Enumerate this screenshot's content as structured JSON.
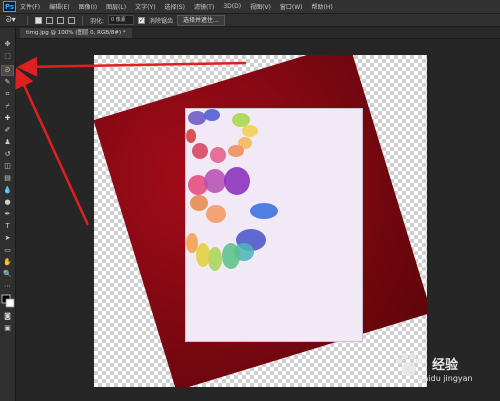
{
  "app": {
    "logo": "Ps"
  },
  "menu": [
    "文件(F)",
    "编辑(E)",
    "图像(I)",
    "图层(L)",
    "文字(Y)",
    "选择(S)",
    "滤镜(T)",
    "3D(D)",
    "视图(V)",
    "窗口(W)",
    "帮助(H)"
  ],
  "options": {
    "feather_label": "羽化:",
    "feather_value": "0 像素",
    "antialias_label": "消除锯齿",
    "select_mask_button": "选择并遮住..."
  },
  "tab": {
    "title": "timg.jpg @ 100% (图层 0, RGB/8#) *"
  },
  "tools": [
    {
      "name": "move-tool",
      "glyph": "✥"
    },
    {
      "name": "marquee-tool",
      "glyph": "⬚"
    },
    {
      "name": "lasso-tool",
      "glyph": "ᘐ"
    },
    {
      "name": "quick-select-tool",
      "glyph": "✎"
    },
    {
      "name": "crop-tool",
      "glyph": "⌗"
    },
    {
      "name": "eyedropper-tool",
      "glyph": "⌿"
    },
    {
      "name": "healing-tool",
      "glyph": "✚"
    },
    {
      "name": "brush-tool",
      "glyph": "✐"
    },
    {
      "name": "stamp-tool",
      "glyph": "♟"
    },
    {
      "name": "history-brush-tool",
      "glyph": "↺"
    },
    {
      "name": "eraser-tool",
      "glyph": "◫"
    },
    {
      "name": "gradient-tool",
      "glyph": "▤"
    },
    {
      "name": "blur-tool",
      "glyph": "💧"
    },
    {
      "name": "dodge-tool",
      "glyph": "●"
    },
    {
      "name": "pen-tool",
      "glyph": "✒"
    },
    {
      "name": "type-tool",
      "glyph": "T"
    },
    {
      "name": "path-select-tool",
      "glyph": "➤"
    },
    {
      "name": "shape-tool",
      "glyph": "▭"
    },
    {
      "name": "hand-tool",
      "glyph": "✋"
    },
    {
      "name": "zoom-tool",
      "glyph": "🔍"
    },
    {
      "name": "more-tools",
      "glyph": "⋯"
    }
  ],
  "watermark": {
    "cn": "经验",
    "en": "Baidu jingyan"
  },
  "colors": {
    "accent_red": "#e02020",
    "mat_red": "#7d0812"
  }
}
